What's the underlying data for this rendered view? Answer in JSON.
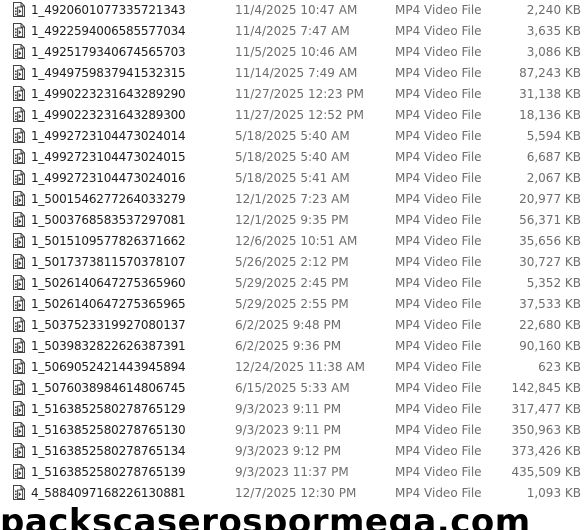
{
  "files": [
    {
      "name": "1_4920601077335721343",
      "date": "11/4/2025 10:47 AM",
      "type": "MP4 Video File",
      "size": "2,240 KB",
      "icon": "video-file-icon"
    },
    {
      "name": "1_4922594006585577034",
      "date": "11/4/2025 7:47 AM",
      "type": "MP4 Video File",
      "size": "3,635 KB",
      "icon": "video-file-icon"
    },
    {
      "name": "1_4925179340674565703",
      "date": "11/5/2025 10:46 AM",
      "type": "MP4 Video File",
      "size": "3,086 KB",
      "icon": "video-file-icon"
    },
    {
      "name": "1_4949759837941532315",
      "date": "11/14/2025 7:49 AM",
      "type": "MP4 Video File",
      "size": "87,243 KB",
      "icon": "video-file-icon"
    },
    {
      "name": "1_4990223231643289290",
      "date": "11/27/2025 12:23 PM",
      "type": "MP4 Video File",
      "size": "31,138 KB",
      "icon": "video-file-icon"
    },
    {
      "name": "1_4990223231643289300",
      "date": "11/27/2025 12:52 PM",
      "type": "MP4 Video File",
      "size": "18,136 KB",
      "icon": "video-file-icon"
    },
    {
      "name": "1_4992723104473024014",
      "date": "5/18/2025 5:40 AM",
      "type": "MP4 Video File",
      "size": "5,594 KB",
      "icon": "video-file-icon"
    },
    {
      "name": "1_4992723104473024015",
      "date": "5/18/2025 5:40 AM",
      "type": "MP4 Video File",
      "size": "6,687 KB",
      "icon": "video-file-icon"
    },
    {
      "name": "1_4992723104473024016",
      "date": "5/18/2025 5:41 AM",
      "type": "MP4 Video File",
      "size": "2,067 KB",
      "icon": "video-file-icon"
    },
    {
      "name": "1_5001546277264033279",
      "date": "12/1/2025 7:23 AM",
      "type": "MP4 Video File",
      "size": "20,977 KB",
      "icon": "video-file-icon"
    },
    {
      "name": "1_5003768583537297081",
      "date": "12/1/2025 9:35 PM",
      "type": "MP4 Video File",
      "size": "56,371 KB",
      "icon": "video-file-icon"
    },
    {
      "name": "1_5015109577826371662",
      "date": "12/6/2025 10:51 AM",
      "type": "MP4 Video File",
      "size": "35,656 KB",
      "icon": "video-file-icon"
    },
    {
      "name": "1_5017373811570378107",
      "date": "5/26/2025 2:12 PM",
      "type": "MP4 Video File",
      "size": "30,727 KB",
      "icon": "video-file-icon"
    },
    {
      "name": "1_5026140647275365960",
      "date": "5/29/2025 2:45 PM",
      "type": "MP4 Video File",
      "size": "5,352 KB",
      "icon": "video-file-icon"
    },
    {
      "name": "1_5026140647275365965",
      "date": "5/29/2025 2:55 PM",
      "type": "MP4 Video File",
      "size": "37,533 KB",
      "icon": "video-file-icon"
    },
    {
      "name": "1_5037523319927080137",
      "date": "6/2/2025 9:48 PM",
      "type": "MP4 Video File",
      "size": "22,680 KB",
      "icon": "video-file-icon"
    },
    {
      "name": "1_5039832822626387391",
      "date": "6/2/2025 9:36 PM",
      "type": "MP4 Video File",
      "size": "90,160 KB",
      "icon": "video-file-icon"
    },
    {
      "name": "1_5069052421443945894",
      "date": "12/24/2025 11:38 AM",
      "type": "MP4 Video File",
      "size": "623 KB",
      "icon": "video-file-icon"
    },
    {
      "name": "1_5076038984614806745",
      "date": "6/15/2025 5:33 AM",
      "type": "MP4 Video File",
      "size": "142,845 KB",
      "icon": "video-file-icon"
    },
    {
      "name": "1_5163852580278765129",
      "date": "9/3/2023 9:11 PM",
      "type": "MP4 Video File",
      "size": "317,477 KB",
      "icon": "video-file-icon"
    },
    {
      "name": "1_5163852580278765130",
      "date": "9/3/2023 9:11 PM",
      "type": "MP4 Video File",
      "size": "350,963 KB",
      "icon": "video-file-icon"
    },
    {
      "name": "1_5163852580278765134",
      "date": "9/3/2023 9:12 PM",
      "type": "MP4 Video File",
      "size": "373,426 KB",
      "icon": "video-file-icon"
    },
    {
      "name": "1_5163852580278765139",
      "date": "9/3/2023 11:37 PM",
      "type": "MP4 Video File",
      "size": "435,509 KB",
      "icon": "video-file-icon"
    },
    {
      "name": "4_5884097168226130881",
      "date": "12/7/2025 12:30 PM",
      "type": "MP4 Video File",
      "size": "1,093 KB",
      "icon": "video-file-icon"
    }
  ],
  "watermark": "packscaserospormega.com",
  "colors": {
    "name_text": "#1e1e1e",
    "detail_text": "#6d6d6d",
    "icon_stroke": "#444444",
    "background": "#ffffff"
  }
}
